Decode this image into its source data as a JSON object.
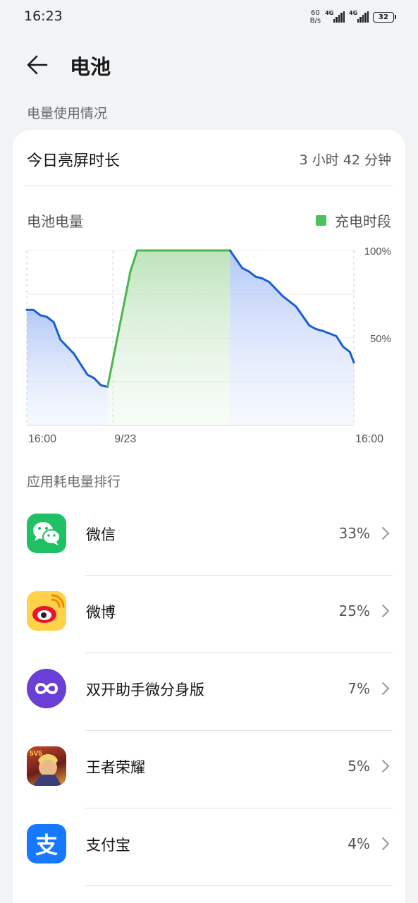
{
  "status": {
    "time": "16:23",
    "net_speed_value": "60",
    "net_speed_unit": "B/s",
    "sim1_tag": "4G",
    "sim2_tag": "4G",
    "battery": "32"
  },
  "header": {
    "title": "电池"
  },
  "usage_section": {
    "label": "电量使用情况"
  },
  "screen_time": {
    "label": "今日亮屏时长",
    "value": "3 小时 42 分钟"
  },
  "chart_section": {
    "title": "电池电量",
    "legend_label": "充电时段",
    "colors": {
      "discharge": "#1a5fd1",
      "charge": "#4cb451"
    }
  },
  "chart_data": {
    "type": "area",
    "title": "电池电量",
    "y_ticks": [
      "100%",
      "50%"
    ],
    "x_ticks": [
      "16:00",
      "9/23",
      "16:00"
    ],
    "ylim": [
      0,
      100
    ],
    "grid": true,
    "legend": "top-right",
    "series": [
      {
        "name": "",
        "values": [
          [
            0.0,
            66
          ],
          [
            0.5,
            66
          ],
          [
            1.0,
            63
          ],
          [
            1.5,
            62
          ],
          [
            2.0,
            59
          ],
          [
            2.5,
            49
          ],
          [
            3.5,
            41
          ],
          [
            4.5,
            29
          ],
          [
            5.0,
            27
          ],
          [
            5.5,
            23
          ],
          [
            6.0,
            22
          ]
        ]
      },
      {
        "name": "充电时段",
        "values": [
          [
            6.0,
            22
          ],
          [
            7.7,
            88
          ],
          [
            8.2,
            100
          ],
          [
            15.1,
            100
          ]
        ]
      },
      {
        "name": "",
        "values": [
          [
            15.1,
            100
          ],
          [
            16.0,
            90
          ],
          [
            16.5,
            88
          ],
          [
            17.0,
            85
          ],
          [
            17.5,
            84
          ],
          [
            18.0,
            82
          ],
          [
            19.0,
            74
          ],
          [
            20.0,
            68
          ],
          [
            21.0,
            57
          ],
          [
            21.5,
            55
          ],
          [
            22.0,
            54
          ],
          [
            23.0,
            51
          ],
          [
            23.5,
            45
          ],
          [
            24.0,
            42
          ],
          [
            24.3,
            36
          ]
        ]
      }
    ]
  },
  "apps_section": {
    "label": "应用耗电量排行",
    "items": [
      {
        "name": "微信",
        "percent": "33%",
        "icon": "wechat-icon"
      },
      {
        "name": "微博",
        "percent": "25%",
        "icon": "weibo-icon"
      },
      {
        "name": "双开助手微分身版",
        "percent": "7%",
        "icon": "dual-app-icon"
      },
      {
        "name": "王者荣耀",
        "percent": "5%",
        "icon": "honor-of-kings-icon",
        "icon_badge": "5V5"
      },
      {
        "name": "支付宝",
        "percent": "4%",
        "icon": "alipay-icon",
        "icon_glyph": "支"
      }
    ]
  }
}
